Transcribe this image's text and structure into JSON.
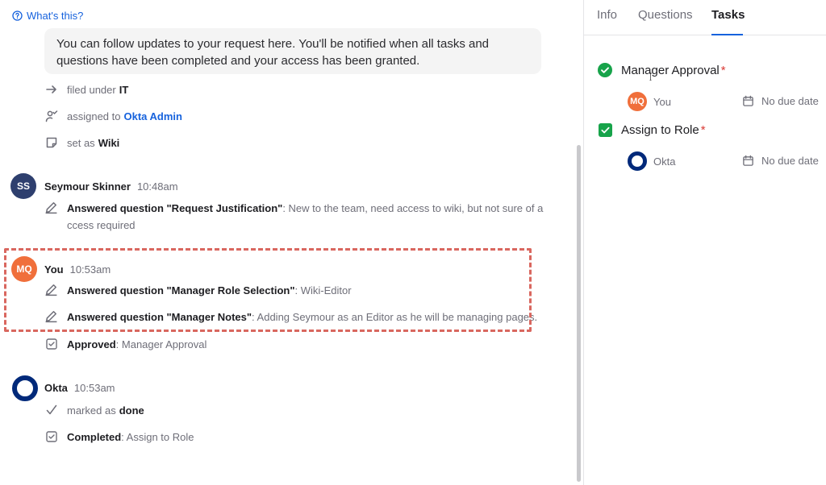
{
  "feed": {
    "whats_this": "What's this?",
    "note": "You can follow updates to your request here. You'll be notified when all tasks and questions have been completed and your access has been granted.",
    "system_events": [
      {
        "prefix": "filed under",
        "value": "IT"
      },
      {
        "prefix": "assigned to",
        "value": "Okta Admin"
      },
      {
        "prefix": "set as",
        "value": "Wiki"
      }
    ],
    "seymour": {
      "initials": "SS",
      "name": "Seymour Skinner",
      "time": "10:48am",
      "answer_label": "Answered question \"Request Justification\"",
      "answer_text": ": New to the team, need access to wiki, but not sure of access required"
    },
    "you": {
      "initials": "MQ",
      "name": "You",
      "time": "10:53am",
      "answers": [
        {
          "label": "Answered question \"Manager Role Selection\"",
          "text": ": Wiki-Editor"
        },
        {
          "label": "Answered question \"Manager Notes\"",
          "text": ": Adding Seymour as an Editor as he will be managing pages."
        }
      ],
      "approved_label": "Approved",
      "approved_text": ": Manager Approval"
    },
    "okta": {
      "name": "Okta",
      "time": "10:53am",
      "marked_prefix": "marked as",
      "marked_value": "done",
      "completed_label": "Completed",
      "completed_text": ": Assign to Role"
    }
  },
  "panel": {
    "tabs": [
      {
        "label": "Info",
        "active": false
      },
      {
        "label": "Questions",
        "active": false
      },
      {
        "label": "Tasks",
        "active": true
      }
    ],
    "tasks": [
      {
        "title": "Manager Approval",
        "required": "*",
        "assignee_initials": "MQ",
        "assignee": "You",
        "due": "No due date"
      },
      {
        "title": "Assign to Role",
        "required": "*",
        "assignee_initials": "",
        "assignee": "Okta",
        "due": "No due date"
      }
    ]
  },
  "colors": {
    "accent": "#1662dd",
    "success": "#17a34a",
    "highlight_border": "#d9675f",
    "okta_blue": "#00297a",
    "you_orange": "#f06f3b",
    "seymour_navy": "#2e3f6e"
  }
}
